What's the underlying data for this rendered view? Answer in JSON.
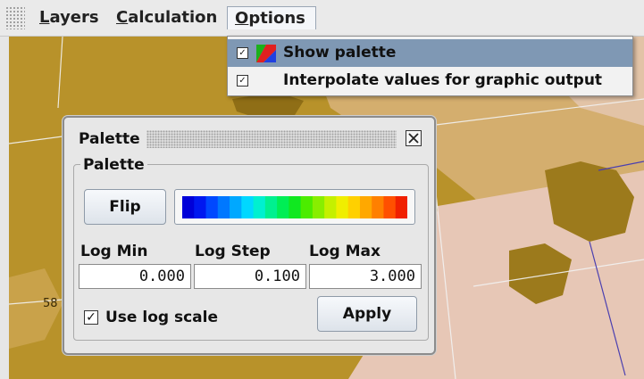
{
  "menubar": {
    "items": [
      {
        "label": "Layers",
        "mnemonic": "L",
        "rest": "ayers"
      },
      {
        "label": "Calculation",
        "mnemonic": "C",
        "rest": "alculation"
      },
      {
        "label": "Options",
        "mnemonic": "O",
        "rest": "ptions"
      }
    ]
  },
  "options_menu": {
    "items": [
      {
        "label": "Show palette",
        "checked": true,
        "highlighted": true
      },
      {
        "label": "Interpolate values for graphic output",
        "checked": true,
        "highlighted": false
      }
    ]
  },
  "map": {
    "visible_labels": [
      "58"
    ],
    "colors": {
      "dark_ochre": "#b8922a",
      "tan": "#d8b37a",
      "pink": "#e7c7b6",
      "land": "#9c7a1c"
    }
  },
  "palette_window": {
    "title": "Palette",
    "group_label": "Palette",
    "flip_label": "Flip",
    "fields": [
      {
        "label": "Log Min",
        "value": "0.000"
      },
      {
        "label": "Log Step",
        "value": "0.100"
      },
      {
        "label": "Log Max",
        "value": "3.000"
      }
    ],
    "use_log_scale": {
      "label": "Use log scale",
      "checked": true
    },
    "apply_label": "Apply",
    "palette_colors": [
      "#0000d8",
      "#0018f0",
      "#0048ff",
      "#0078ff",
      "#00a8ff",
      "#00d8ff",
      "#00f0d0",
      "#00f090",
      "#00ee55",
      "#10e820",
      "#4cec00",
      "#88ee00",
      "#c4f000",
      "#f0ee00",
      "#ffd000",
      "#ffa800",
      "#ff8000",
      "#ff5000",
      "#f02000"
    ]
  }
}
